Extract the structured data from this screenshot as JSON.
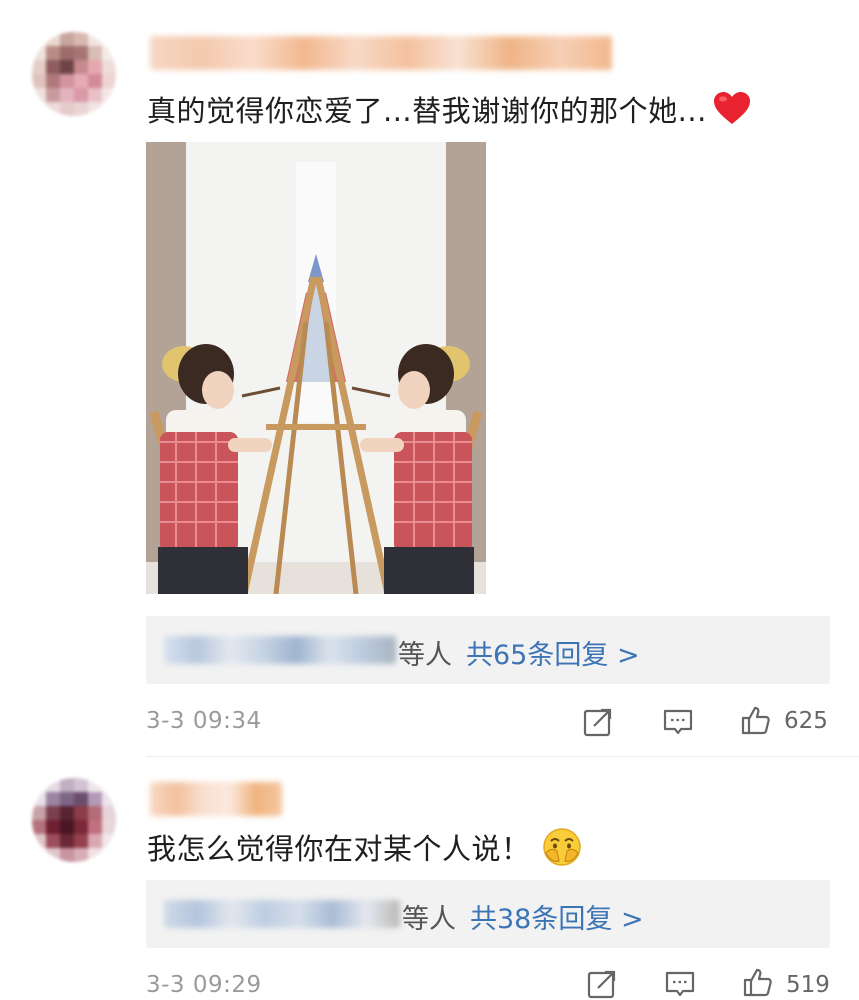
{
  "comments": [
    {
      "text": "真的觉得你恋爱了...替我谢谢你的那个她...",
      "emoji": "red-heart",
      "reply_suffix": "等人",
      "reply_count_text": "共65条回复 >",
      "timestamp": "3-3 09:34",
      "likes": "625"
    },
    {
      "text": "我怎么觉得你在对某个人说！",
      "emoji": "face-covering-mouth",
      "reply_suffix": "等人",
      "reply_count_text": "共38条回复 >",
      "timestamp": "3-3 09:29",
      "likes": "519"
    }
  ],
  "colors": {
    "link": "#3d74b6",
    "reply_bg": "#f2f2f2",
    "meta": "#9a9a9a",
    "heart": "#e8232f"
  }
}
